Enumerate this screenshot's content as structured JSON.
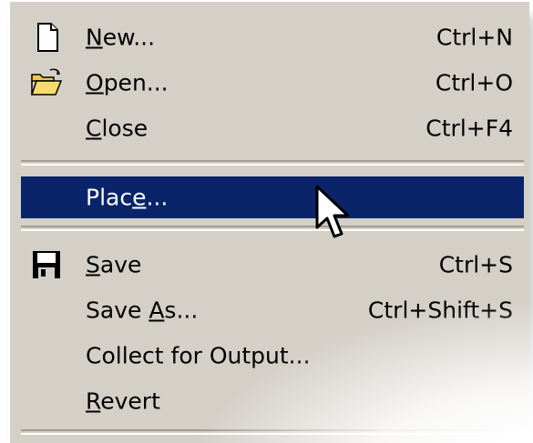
{
  "menu": {
    "items": [
      {
        "label": "New...",
        "underline": "N",
        "shortcut": "Ctrl+N",
        "icon": "new-file-icon"
      },
      {
        "label": "Open...",
        "underline": "O",
        "shortcut": "Ctrl+O",
        "icon": "open-folder-icon"
      },
      {
        "label": "Close",
        "underline": "C",
        "shortcut": "Ctrl+F4",
        "icon": ""
      },
      {
        "label": "Place...",
        "underline": "e",
        "shortcut": "",
        "icon": "",
        "selected": true
      },
      {
        "label": "Save",
        "underline": "S",
        "shortcut": "Ctrl+S",
        "icon": "save-disk-icon"
      },
      {
        "label": "Save As...",
        "underline": "A",
        "shortcut": "Ctrl+Shift+S",
        "icon": ""
      },
      {
        "label": "Collect for Output...",
        "underline": "",
        "shortcut": "",
        "icon": ""
      },
      {
        "label": "Revert",
        "underline": "R",
        "shortcut": "",
        "icon": ""
      }
    ]
  },
  "colors": {
    "menu_bg": "#d4d0c8",
    "highlight_bg": "#0a246a",
    "highlight_text": "#ffffff"
  }
}
